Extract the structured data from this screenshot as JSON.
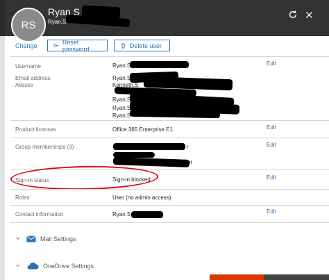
{
  "header": {
    "avatar_initials": "RS",
    "name": "Ryan S",
    "email": "Ryan.S",
    "refresh_icon": "refresh-icon",
    "close_icon": "close-icon"
  },
  "actions": {
    "change_label": "Change",
    "reset_password_label": "Reset password",
    "delete_user_label": "Delete user"
  },
  "fields": {
    "username": {
      "label": "Username",
      "value": "Ryan.S",
      "edit": "Edit"
    },
    "email": {
      "label": "Email address",
      "value": "Ryan.S",
      "edit": ""
    },
    "aliases": {
      "label": "Aliases",
      "values": [
        "Kenneth.S",
        "Ryan.S",
        "Ryan.S",
        "Ryan.S"
      ]
    },
    "licenses": {
      "label": "Product licenses",
      "value": "Office 365 Enterprise E1",
      "edit": "Edit"
    },
    "groups": {
      "label": "Group memberships (3)",
      "value_suffix": "r",
      "value_suffix2": "or",
      "edit": "Edit"
    },
    "signin": {
      "label": "Sign-in status",
      "value": "Sign-in blocked",
      "edit": "Edit"
    },
    "roles": {
      "label": "Roles",
      "value": "User (no admin access)"
    },
    "contact": {
      "label": "Contact information",
      "value": "Ryan S",
      "edit": "Edit"
    }
  },
  "sections": [
    {
      "title": "Mail Settings",
      "icon": "mail-icon"
    },
    {
      "title": "OneDrive Settings",
      "icon": "cloud-icon"
    }
  ],
  "colors": {
    "header_bg": "#333333",
    "accent": "#2b73b6",
    "annotation": "#e0001b"
  }
}
